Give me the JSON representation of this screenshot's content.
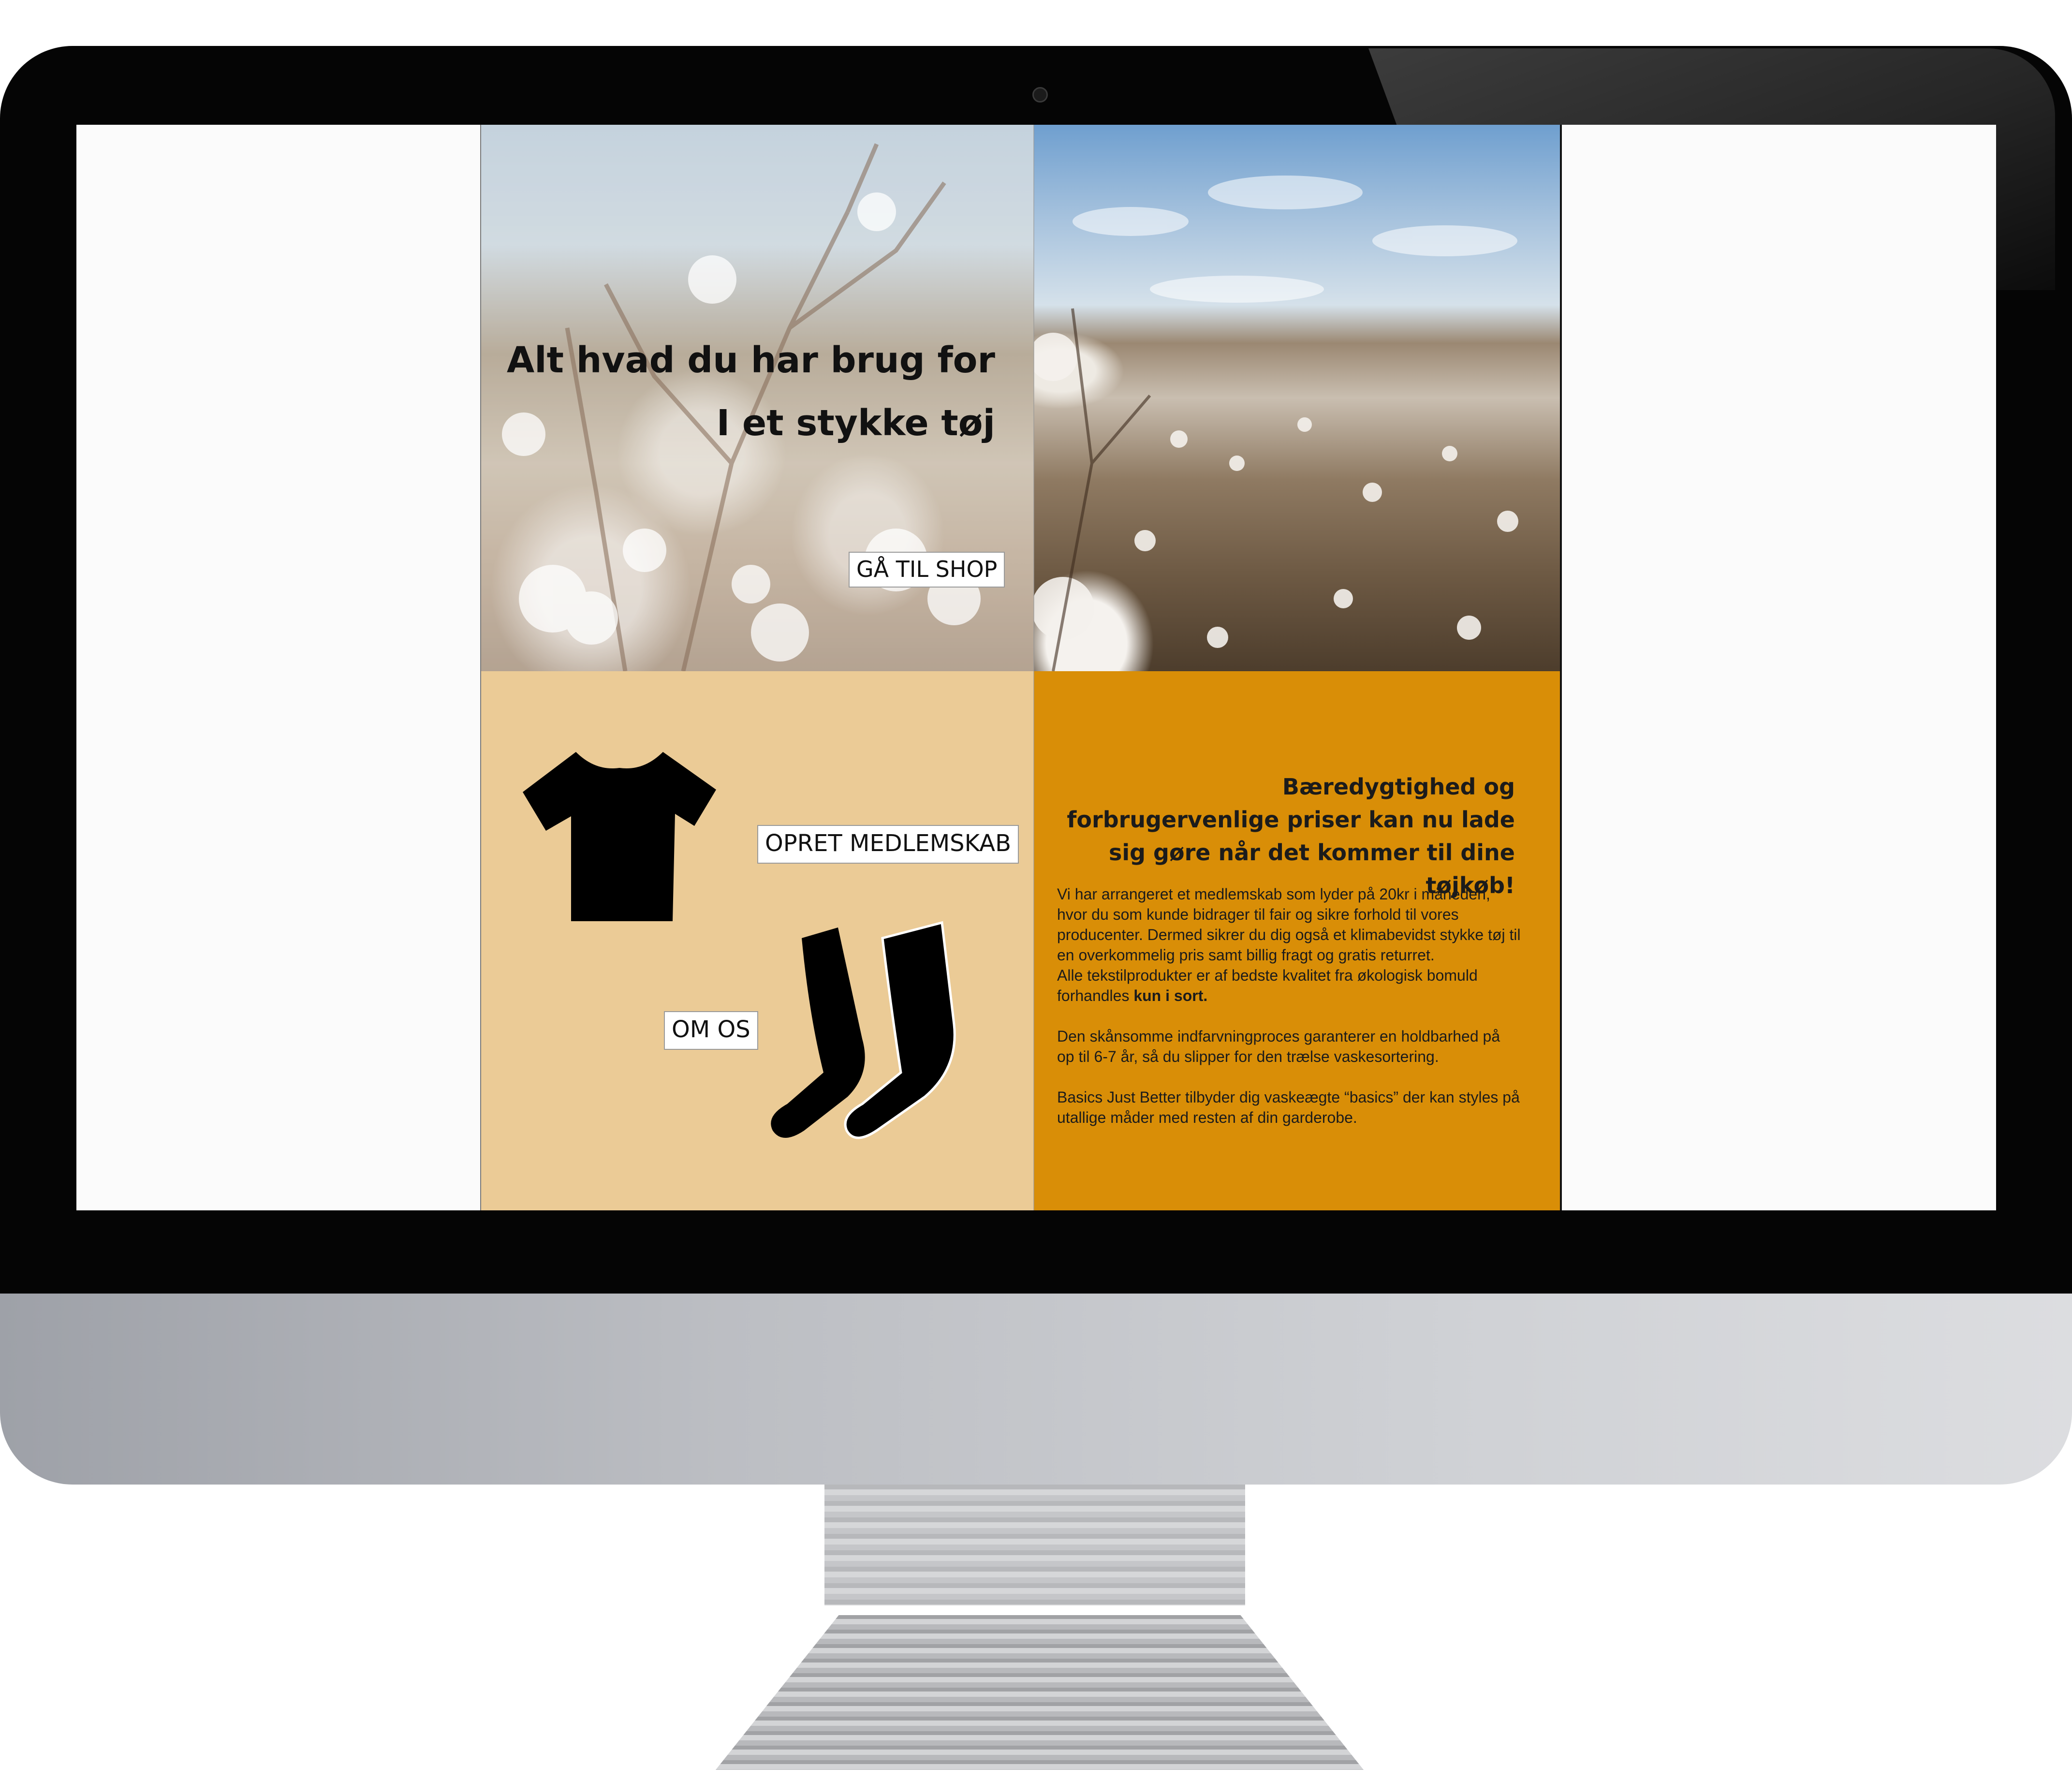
{
  "hero": {
    "title_line1": "Alt hvad du har brug for",
    "title_line2": "I et stykke tøj",
    "shop_button": "GÅ TIL SHOP"
  },
  "left_panel": {
    "member_button": "OPRET MEDLEMSKAB",
    "about_button": "OM OS",
    "icons": [
      "tshirt-icon",
      "socks-icon"
    ]
  },
  "right_panel": {
    "heading": "Bæredygtighed og forbrugervenlige priser kan nu lade sig gøre når det kommer til dine tøjkøb!",
    "paragraph1_part1": "Vi har arrangeret et medlemskab som lyder på 20kr i måneden, hvor du som kunde bidrager til fair og sikre forhold til vores producenter. Dermed sikrer du dig også et klimabevidst stykke tøj til en overkommelig pris samt billig fragt og gratis returret.",
    "paragraph1_part2": "Alle tekstilprodukter er af bedste kvalitet fra økologisk bomuld forhandles",
    "paragraph1_bold": "kun i sort.",
    "paragraph2": "Den skånsomme indfarvningproces garanterer en holdbarhed på op til 6-7 år, så du slipper for den trælse vaskesortering.",
    "paragraph3": "Basics Just Better tilbyder dig vaskeægte “basics” der kan styles på utallige måder med resten af din garderobe."
  },
  "colors": {
    "left_panel_bg": "#ebcb96",
    "right_panel_bg": "#d98e07",
    "bezel": "#050505",
    "screen_bg": "#fbfbfb"
  }
}
